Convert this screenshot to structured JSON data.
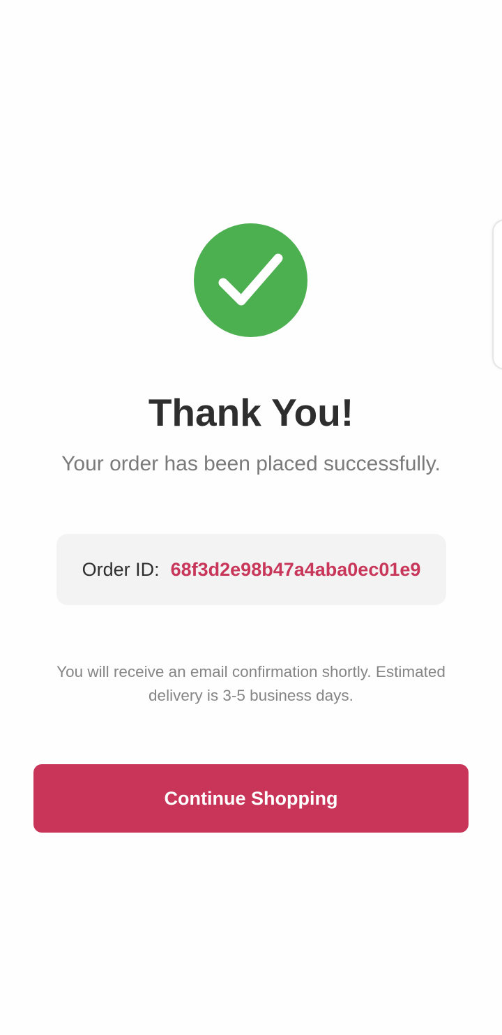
{
  "confirmation": {
    "icon": "checkmark-icon",
    "title": "Thank You!",
    "subtitle": "Your order has been placed successfully.",
    "order": {
      "label": "Order ID:",
      "value": "68f3d2e98b47a4aba0ec01e9"
    },
    "note": "You will receive an email confirmation shortly. Estimated delivery is 3-5 business days.",
    "continue_label": "Continue Shopping"
  },
  "colors": {
    "success": "#4caf50",
    "accent": "#c83559",
    "title": "#2e2e2e",
    "muted": "#7a7a7a",
    "order_box_bg": "#f3f3f3"
  }
}
